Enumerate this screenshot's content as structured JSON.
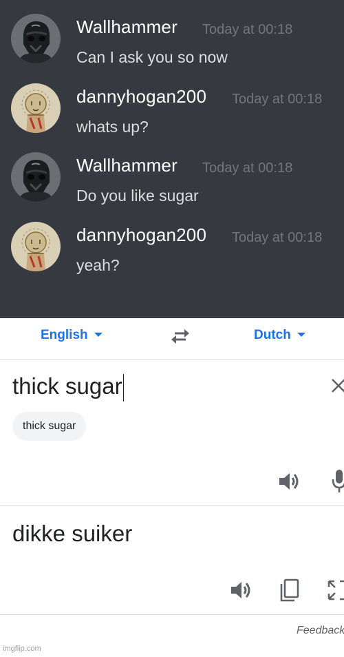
{
  "chat": {
    "messages": [
      {
        "user": "Wallhammer",
        "timestamp": "Today at 00:18",
        "text": "Can I ask you so now",
        "avatar": "stormtrooper-avatar"
      },
      {
        "user": "dannyhogan200",
        "timestamp": "Today at 00:18",
        "text": "whats up?",
        "avatar": "drawing-avatar"
      },
      {
        "user": "Wallhammer",
        "timestamp": "Today at 00:18",
        "text": "Do you like sugar",
        "avatar": "stormtrooper-avatar"
      },
      {
        "user": "dannyhogan200",
        "timestamp": "Today at 00:18",
        "text": "yeah?",
        "avatar": "drawing-avatar"
      }
    ],
    "colors": {
      "background": "#36393f",
      "username": "#ffffff",
      "timestamp": "#72767d",
      "text": "#dcddde"
    }
  },
  "translate": {
    "source_language": "English",
    "target_language": "Dutch",
    "input_text": "thick sugar",
    "suggestion_chip": "thick sugar",
    "translation": "dikke suiker",
    "feedback_label": "Feedback",
    "icons": [
      "swap-languages-icon",
      "clear-icon",
      "speaker-icon",
      "microphone-icon",
      "copy-icon",
      "fullscreen-icon"
    ],
    "accent_color": "#1a73e8"
  },
  "watermark": "imgflip.com"
}
